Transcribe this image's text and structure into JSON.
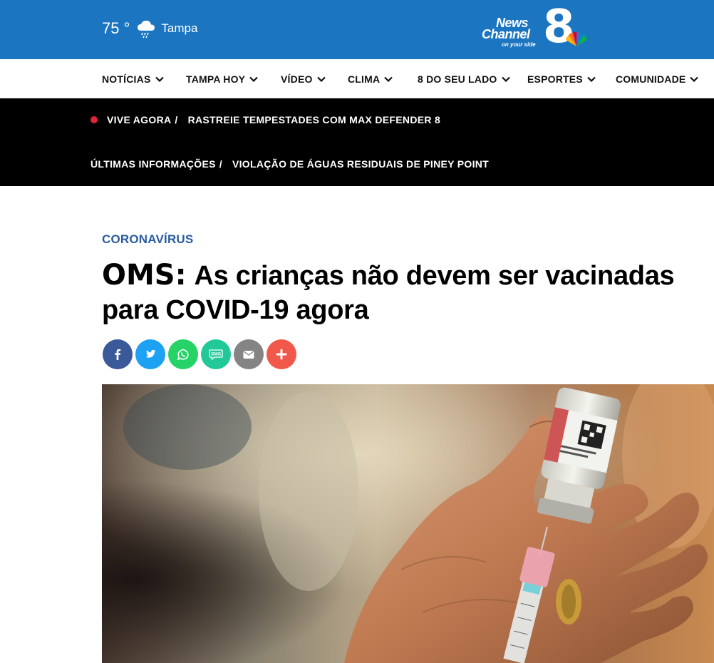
{
  "weather": {
    "temperature": "75 °",
    "city": "Tampa",
    "icon": "rain-cloud-icon"
  },
  "logo": {
    "line1": "News",
    "line2": "Channel",
    "number": "8",
    "tagline": "on your side"
  },
  "nav": {
    "items": [
      {
        "label": "NOTÍCIAS"
      },
      {
        "label": "TAMPA HOY"
      },
      {
        "label": "VÍDEO"
      },
      {
        "label": "CLIMA"
      },
      {
        "label": "8 DO SEU LADO"
      },
      {
        "label": "ESPORTES"
      },
      {
        "label": "COMUNIDADE"
      }
    ]
  },
  "breaking": {
    "live_label": "VIVE AGORA",
    "live_link": "RASTREIE TEMPESTADES COM MAX DEFENDER 8",
    "latest_label": "ÚLTIMAS INFORMAÇÕES",
    "latest_link": "VIOLAÇÃO DE ÁGUAS RESIDUAIS DE PINEY POINT",
    "separator": "/"
  },
  "article": {
    "kicker": "CORONAVÍRUS",
    "headline_lead": "OMS:",
    "headline_rest": "As crianças não devem ser vacinadas para COVID-19 agora"
  },
  "share": {
    "buttons": [
      {
        "name": "facebook",
        "color": "#3b5998"
      },
      {
        "name": "twitter",
        "color": "#1da1f2"
      },
      {
        "name": "whatsapp",
        "color": "#25d366"
      },
      {
        "name": "sms",
        "color": "#20c997",
        "text": "SMS"
      },
      {
        "name": "email",
        "color": "#848484"
      },
      {
        "name": "more",
        "color": "#f0594a"
      }
    ]
  },
  "colors": {
    "brand_blue": "#1c75c0",
    "kicker_blue": "#2a5c9e",
    "live_red": "#e0243a"
  }
}
